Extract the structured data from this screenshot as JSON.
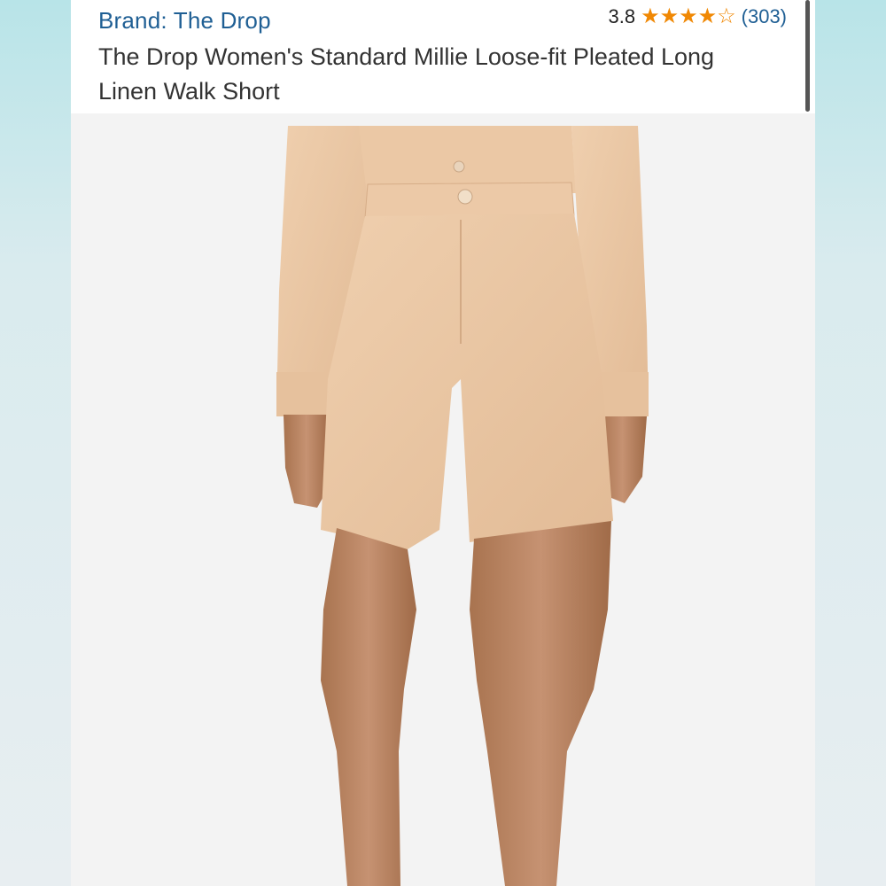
{
  "product": {
    "brand": "Brand: The Drop",
    "rating_value": "3.8",
    "rating_stars": 3.8,
    "review_count": "(303)",
    "title": "The Drop Women's Standard Millie Loose-fit Pleated Long Linen Walk Short"
  },
  "colors": {
    "link": "#1f5f94",
    "star": "#f08804",
    "fabric": "#ecc9a7",
    "skin": "#b98560"
  },
  "icons": {
    "star_full": "star-icon",
    "star_empty": "star-outline-icon"
  }
}
